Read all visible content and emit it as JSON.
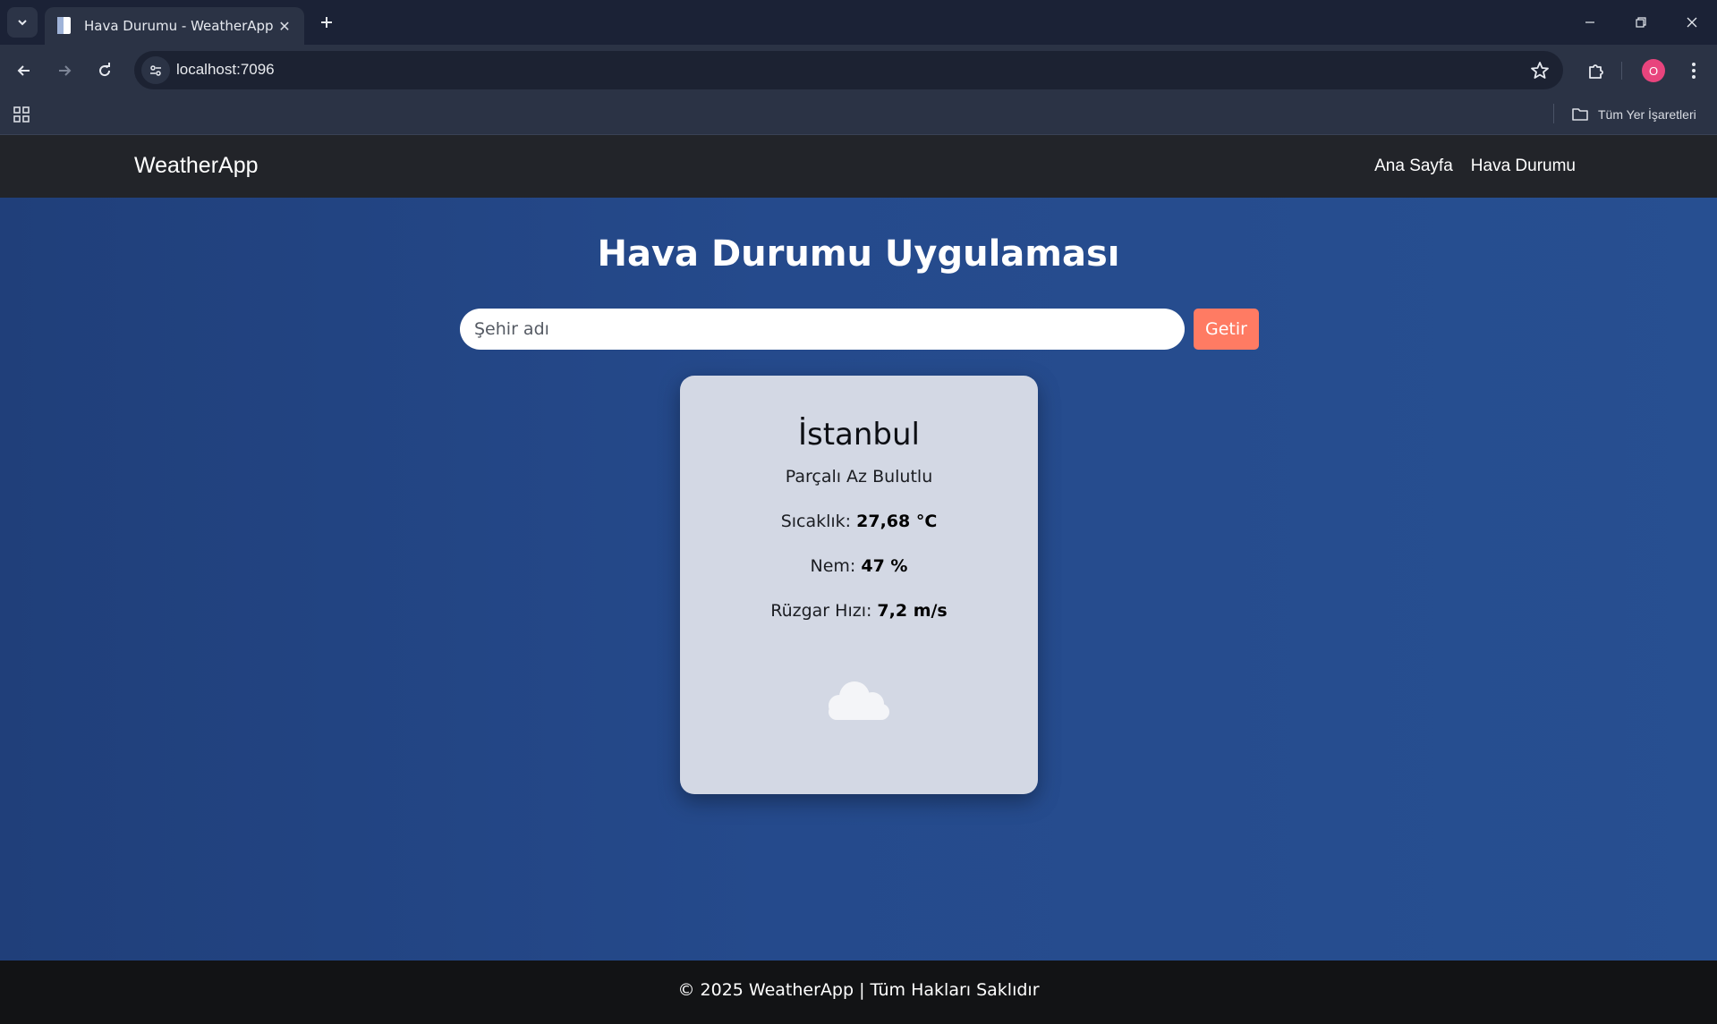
{
  "browser": {
    "tab_title": "Hava Durumu - WeatherApp",
    "url": "localhost:7096",
    "profile_initial": "O",
    "bookmarks_all_label": "Tüm Yer İşaretleri"
  },
  "nav": {
    "brand": "WeatherApp",
    "links": [
      "Ana Sayfa",
      "Hava Durumu"
    ]
  },
  "hero": {
    "title": "Hava Durumu Uygulaması",
    "search_placeholder": "Şehir adı",
    "search_value": "",
    "button_label": "Getir"
  },
  "weather": {
    "city": "İstanbul",
    "description": "Parçalı Az Bulutlu",
    "temperature_label": "Sıcaklık:",
    "temperature_value": "27,68 °C",
    "humidity_label": "Nem:",
    "humidity_value": "47 %",
    "wind_label": "Rüzgar Hızı:",
    "wind_value": "7,2 m/s",
    "icon": "cloud-icon"
  },
  "footer": {
    "text": "© 2025 WeatherApp | Tüm Hakları Saklıdır"
  },
  "colors": {
    "hero_bg": "#254a8c",
    "button": "#ff7b63",
    "card_bg": "#d3d8e4",
    "nav_bg": "#222429",
    "footer_bg": "#121315",
    "avatar": "#e8447d"
  }
}
